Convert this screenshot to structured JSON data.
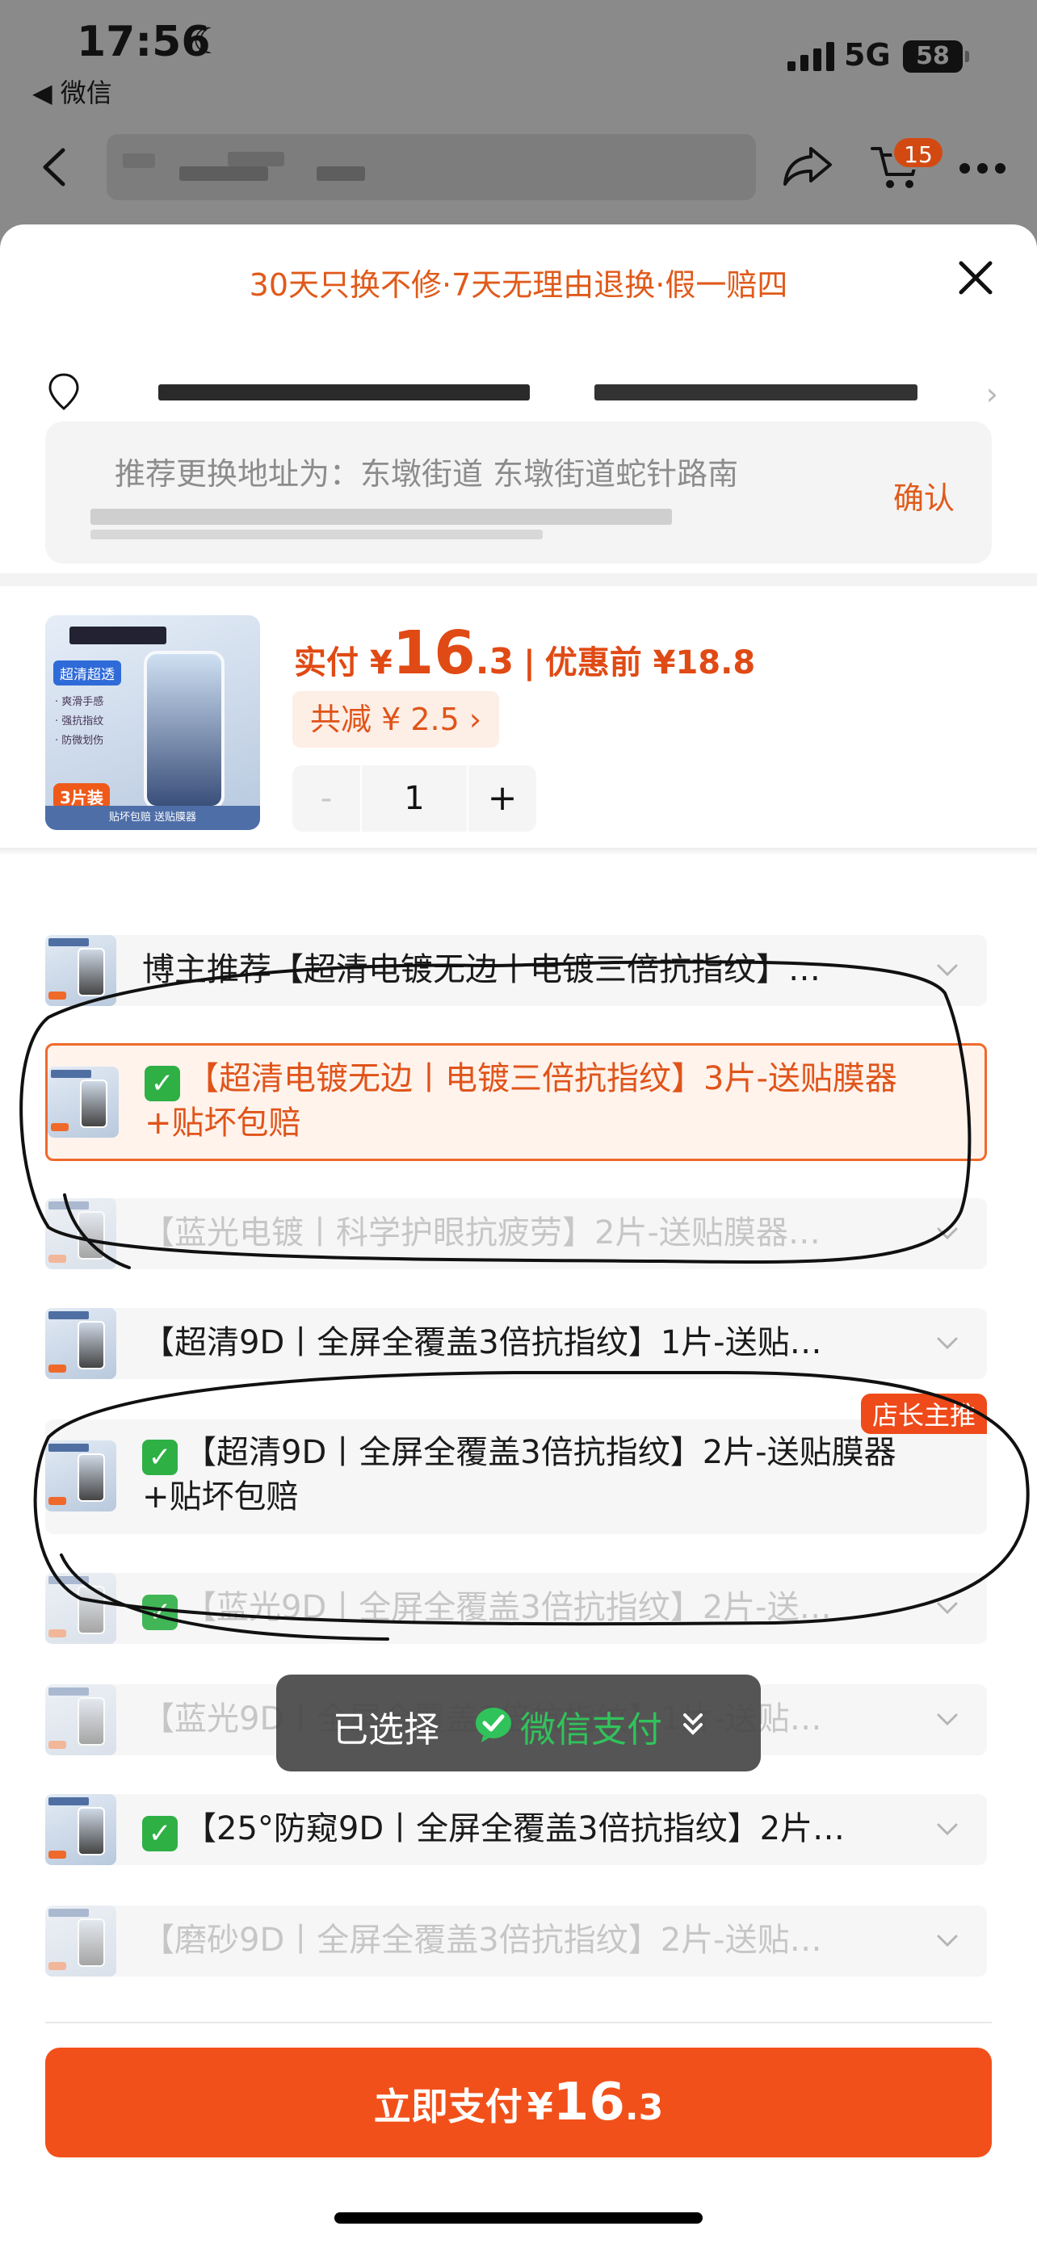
{
  "status_bar": {
    "time": "17:56",
    "back_app": "◀ 微信",
    "network": "5G",
    "battery": "58"
  },
  "nav": {
    "cart_count": "15"
  },
  "sheet": {
    "guarantee": "30天只换不修·7天无理由退换·假一赔四",
    "address_suggestion": "推荐更换地址为：东墩街道 东墩街道蛇针路南",
    "confirm_label": "确认"
  },
  "product": {
    "image_tag": "超清超透",
    "image_features": [
      "· 爽滑手感",
      "· 强抗指纹",
      "· 防微划伤"
    ],
    "image_pack": "3片装",
    "image_footer": "贴坏包赔 送贴膜器",
    "price_label": "实付 ¥",
    "price_int": "16",
    "price_dec": ".3",
    "price_sep": "|",
    "price_before": "优惠前 ¥18.8",
    "discount": "共减 ¥ 2.5 ›",
    "quantity": "1",
    "minus": "-",
    "plus": "+"
  },
  "options": [
    {
      "text": "博主推荐【超清电镀无边丨电镀三倍抗指纹】…",
      "state": "normal",
      "check": false
    },
    {
      "text": "【超清电镀无边丨电镀三倍抗指纹】3片-送贴膜器+贴坏包赔",
      "state": "selected",
      "check": true
    },
    {
      "text": "【蓝光电镀丨科学护眼抗疲劳】2片-送贴膜器…",
      "state": "disabled",
      "check": false
    },
    {
      "text": "【超清9D丨全屏全覆盖3倍抗指纹】1片-送贴…",
      "state": "normal",
      "check": false
    },
    {
      "text": "【超清9D丨全屏全覆盖3倍抗指纹】2片-送贴膜器+贴坏包赔",
      "state": "normal",
      "check": true,
      "badge": "店长主推"
    },
    {
      "text": "【蓝光9D丨全屏全覆盖3倍抗指纹】2片-送…",
      "state": "disabled",
      "check": true
    },
    {
      "text": "【蓝光9D丨全屏全覆盖3倍抗指纹】1片-送贴…",
      "state": "disabled",
      "check": false
    },
    {
      "text": "【25°防窥9D丨全屏全覆盖3倍抗指纹】2片…",
      "state": "normal",
      "check": true
    },
    {
      "text": "【磨砂9D丨全屏全覆盖3倍抗指纹】2片-送贴…",
      "state": "disabled",
      "check": false
    }
  ],
  "toast": {
    "label": "已选择",
    "method": "微信支付"
  },
  "pay_button": {
    "label": "立即支付",
    "yen": "¥",
    "amount_int": "16",
    "amount_dec": ".3"
  },
  "colors": {
    "accent": "#f2501a",
    "selected_border": "#ef6a2a",
    "wechat_green": "#31c35b",
    "check_green": "#2eb045"
  }
}
